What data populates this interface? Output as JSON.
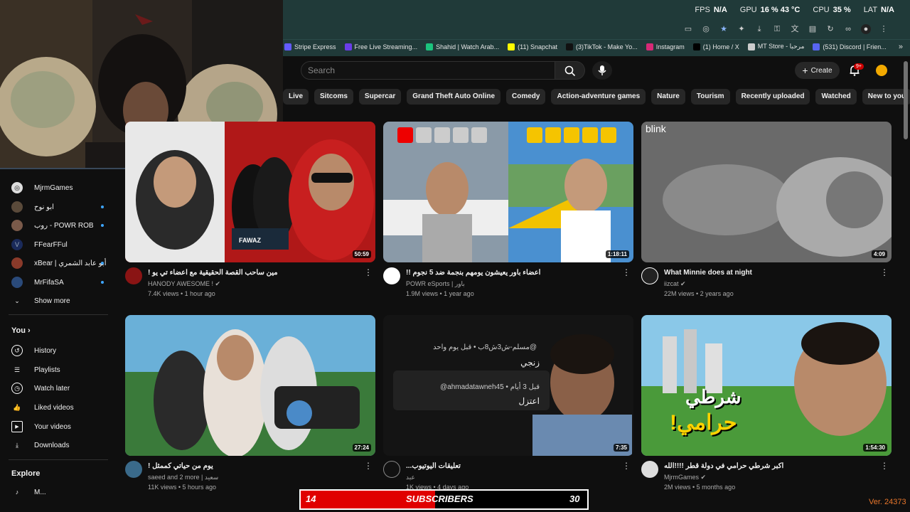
{
  "perf": {
    "fps_label": "FPS",
    "fps_value": "N/A",
    "gpu_label": "GPU",
    "gpu_value": "16 % 43 °C",
    "cpu_label": "CPU",
    "cpu_value": "35 %",
    "lat_label": "LAT",
    "lat_value": "N/A"
  },
  "bookmarks": [
    {
      "label": "Stripe Express",
      "color": "#635bff"
    },
    {
      "label": "Free Live Streaming...",
      "color": "#6a3de8"
    },
    {
      "label": "Shahid | Watch Arab...",
      "color": "#1bc47d"
    },
    {
      "label": "(11) Snapchat",
      "color": "#fffc00"
    },
    {
      "label": "(3)TikTok - Make Yo...",
      "color": "#111111"
    },
    {
      "label": "Instagram",
      "color": "#d62976"
    },
    {
      "label": "(1) Home / X",
      "color": "#000000"
    },
    {
      "label": "MT Store - مرحبا",
      "color": "#cccccc"
    },
    {
      "label": "(531) Discord | Frien...",
      "color": "#5865f2"
    }
  ],
  "header": {
    "search_placeholder": "Search",
    "create_label": "Create",
    "notif_count": "9+"
  },
  "chips": [
    "Live",
    "Sitcoms",
    "Supercar",
    "Grand Theft Auto Online",
    "Comedy",
    "Action-adventure games",
    "Nature",
    "Tourism",
    "Recently uploaded",
    "Watched",
    "New to you"
  ],
  "sidebar": {
    "subs": [
      {
        "label": "MjrmGames",
        "color": "#444"
      },
      {
        "label": "ابو نوح",
        "color": "#5a4a3a"
      },
      {
        "label": "روب - POWR ROB",
        "color": "#7a5a4a"
      },
      {
        "label": "FFearFFul",
        "color": "#1a2a5a"
      },
      {
        "label": "xBear | أبو عابد الشمري",
        "color": "#8a3a2a"
      },
      {
        "label": "MrFifaSA",
        "color": "#2a4a7a"
      }
    ],
    "show_more": "Show more",
    "you": "You",
    "you_items": [
      "History",
      "Playlists",
      "Watch later",
      "Liked videos",
      "Your videos",
      "Downloads"
    ],
    "explore": "Explore",
    "explore_partial": "M..."
  },
  "videos": [
    {
      "title": "مين ساحب القصة الحقيقية مع اعضاء تي يو !",
      "channel": "HANODY AWESOME !",
      "meta": "7.4K views • 1 hour ago",
      "duration": "50:59",
      "thumb": "#8a1414"
    },
    {
      "title": "اعضاء باور يعيشون يومهم بنجمة ضد 5 نجوم !!",
      "channel": "POWR eSports | باور",
      "meta": "1.9M views • 1 year ago",
      "duration": "1:18:11",
      "thumb": "#6a7a8a"
    },
    {
      "title": "What Minnie does at night",
      "channel": "iizcat",
      "meta": "22M views • 2 years ago",
      "duration": "4:09",
      "thumb": "#555"
    },
    {
      "title": "يوم من حياتي كممثل !",
      "channel": "saeed and 2 more | سعيد",
      "meta": "11K views • 5 hours ago",
      "duration": "27:24",
      "thumb": "#3a6a8a"
    },
    {
      "title": "تعليقات اليوتيوب...",
      "channel": "عبد",
      "meta": "1K views • 4 days ago",
      "duration": "7:35",
      "thumb": "#1a1a1a"
    },
    {
      "title": "اكبر شرطي حرامي في دولة قطر !!!!الله",
      "channel": "MjrmGames",
      "meta": "2M views • 5 months ago",
      "duration": "1:54:30",
      "thumb": "#4a8a4a"
    }
  ],
  "thumb_text": {
    "blink": "blink",
    "comment1_user": "@مسلم-ش3ش8ب • قبل يوم واحد",
    "comment1_text": "زنجي",
    "comment2_user": "@ahmadatawneh45 • قبل 3 أيام",
    "comment2_text": "اعتزل",
    "poster_line1": "شرطي",
    "poster_line2": "حرامي!",
    "fawaz": "FAWAZ"
  },
  "subscriber_bar": {
    "current": "14",
    "label": "SUBSCRIBERS",
    "goal": "30",
    "fill_fraction": 0.47
  },
  "version": "Ver. 24373"
}
